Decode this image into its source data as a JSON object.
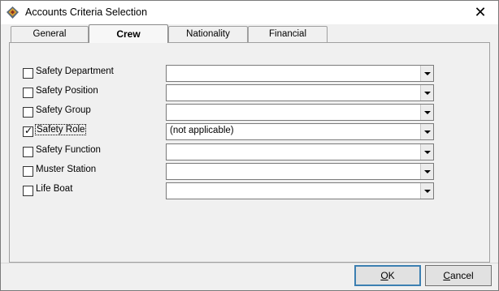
{
  "window": {
    "title": "Accounts Criteria Selection",
    "close_glyph": "✕",
    "app_icon": "app-icon"
  },
  "tabs": [
    {
      "label": "General",
      "active": false
    },
    {
      "label": "Crew",
      "active": true
    },
    {
      "label": "Nationality",
      "active": false
    },
    {
      "label": "Financial",
      "active": false
    }
  ],
  "criteria": [
    {
      "label": "Safety Department",
      "checked": false,
      "value": ""
    },
    {
      "label": "Safety Position",
      "checked": false,
      "value": ""
    },
    {
      "label": "Safety Group",
      "checked": false,
      "value": ""
    },
    {
      "label": "Safety Role",
      "checked": true,
      "value": "(not applicable)"
    },
    {
      "label": "Safety Function",
      "checked": false,
      "value": ""
    },
    {
      "label": "Muster Station",
      "checked": false,
      "value": ""
    },
    {
      "label": "Life Boat",
      "checked": false,
      "value": ""
    }
  ],
  "footer": {
    "ok": {
      "first": "O",
      "rest": "K"
    },
    "cancel": {
      "first": "C",
      "rest": "ancel"
    }
  },
  "colors": {
    "window_bg": "#f0f0f0",
    "titlebar_bg": "#ffffff",
    "default_button_border": "#3c7fb1"
  }
}
